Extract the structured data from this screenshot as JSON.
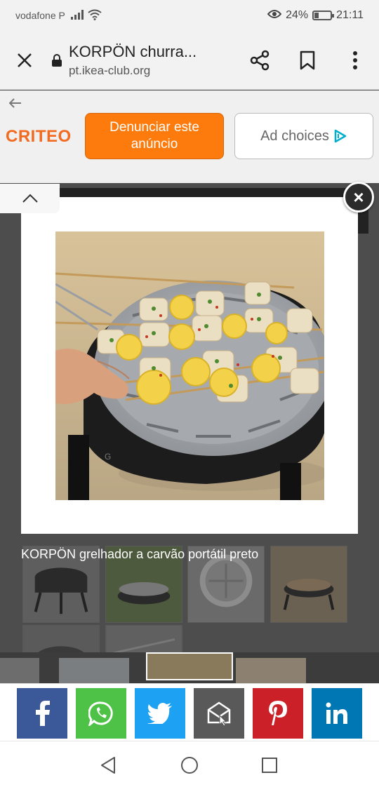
{
  "status_bar": {
    "carrier": "vodafone P",
    "battery_percent": "24%",
    "battery_level": 0.24,
    "time": "21:11"
  },
  "toolbar": {
    "title": "KORPÖN churra...",
    "url": "pt.ikea-club.org"
  },
  "ad": {
    "logo": "CRITEO",
    "report_label": "Denunciar este anúncio",
    "choices_label": "Ad choices"
  },
  "lightbox": {
    "close_label": "×",
    "caption": "KORPÖN grelhador a carvão portátil preto"
  },
  "share": [
    {
      "name": "facebook",
      "color": "#3b5998"
    },
    {
      "name": "whatsapp",
      "color": "#4dc247"
    },
    {
      "name": "twitter",
      "color": "#1da1f2"
    },
    {
      "name": "email",
      "color": "#595959"
    },
    {
      "name": "pinterest",
      "color": "#cb2027"
    },
    {
      "name": "linkedin",
      "color": "#0077b5"
    }
  ],
  "colors": {
    "criteo_orange": "#f26b21",
    "report_button": "#fd7b0c",
    "adchoices_blue": "#00aecd"
  }
}
